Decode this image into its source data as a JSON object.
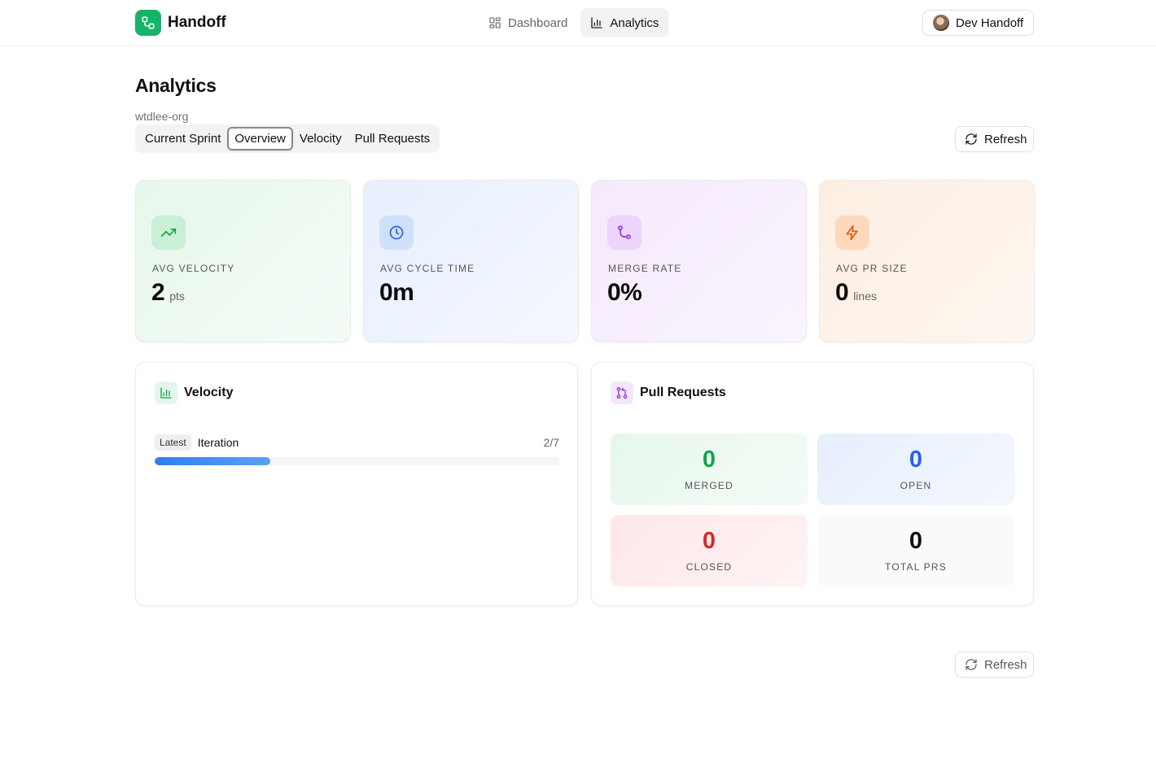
{
  "app": {
    "name": "Handoff"
  },
  "nav": {
    "items": [
      {
        "label": "Dashboard"
      },
      {
        "label": "Analytics"
      }
    ]
  },
  "user": {
    "name": "Dev Handoff"
  },
  "page": {
    "title": "Analytics",
    "org": "wtdlee-org"
  },
  "tabs": [
    {
      "label": "Current Sprint"
    },
    {
      "label": "Overview"
    },
    {
      "label": "Velocity"
    },
    {
      "label": "Pull Requests"
    }
  ],
  "refresh_label": "Refresh",
  "stats": [
    {
      "label": "AVG VELOCITY",
      "value": "2",
      "unit": "pts",
      "icon": "trending-up-icon",
      "color": "#16a34a"
    },
    {
      "label": "AVG CYCLE TIME",
      "value": "0m",
      "unit": "",
      "icon": "clock-icon",
      "color": "#2563eb"
    },
    {
      "label": "MERGE RATE",
      "value": "0%",
      "unit": "",
      "icon": "git-merge-icon",
      "color": "#9333ea"
    },
    {
      "label": "AVG PR SIZE",
      "value": "0",
      "unit": "lines",
      "icon": "zap-icon",
      "color": "#ea580c"
    }
  ],
  "velocity": {
    "title": "Velocity",
    "badge": "Latest",
    "iteration_label": "Iteration",
    "ratio": "2/7",
    "progress": 0.2857
  },
  "pull_requests": {
    "title": "Pull Requests",
    "merged": {
      "value": "0",
      "label": "MERGED",
      "color": "#16a34a"
    },
    "open": {
      "value": "0",
      "label": "OPEN",
      "color": "#2563eb"
    },
    "closed": {
      "value": "0",
      "label": "CLOSED",
      "color": "#dc2626"
    },
    "total": {
      "value": "0",
      "label": "TOTAL PRS",
      "color": "#111111"
    }
  }
}
